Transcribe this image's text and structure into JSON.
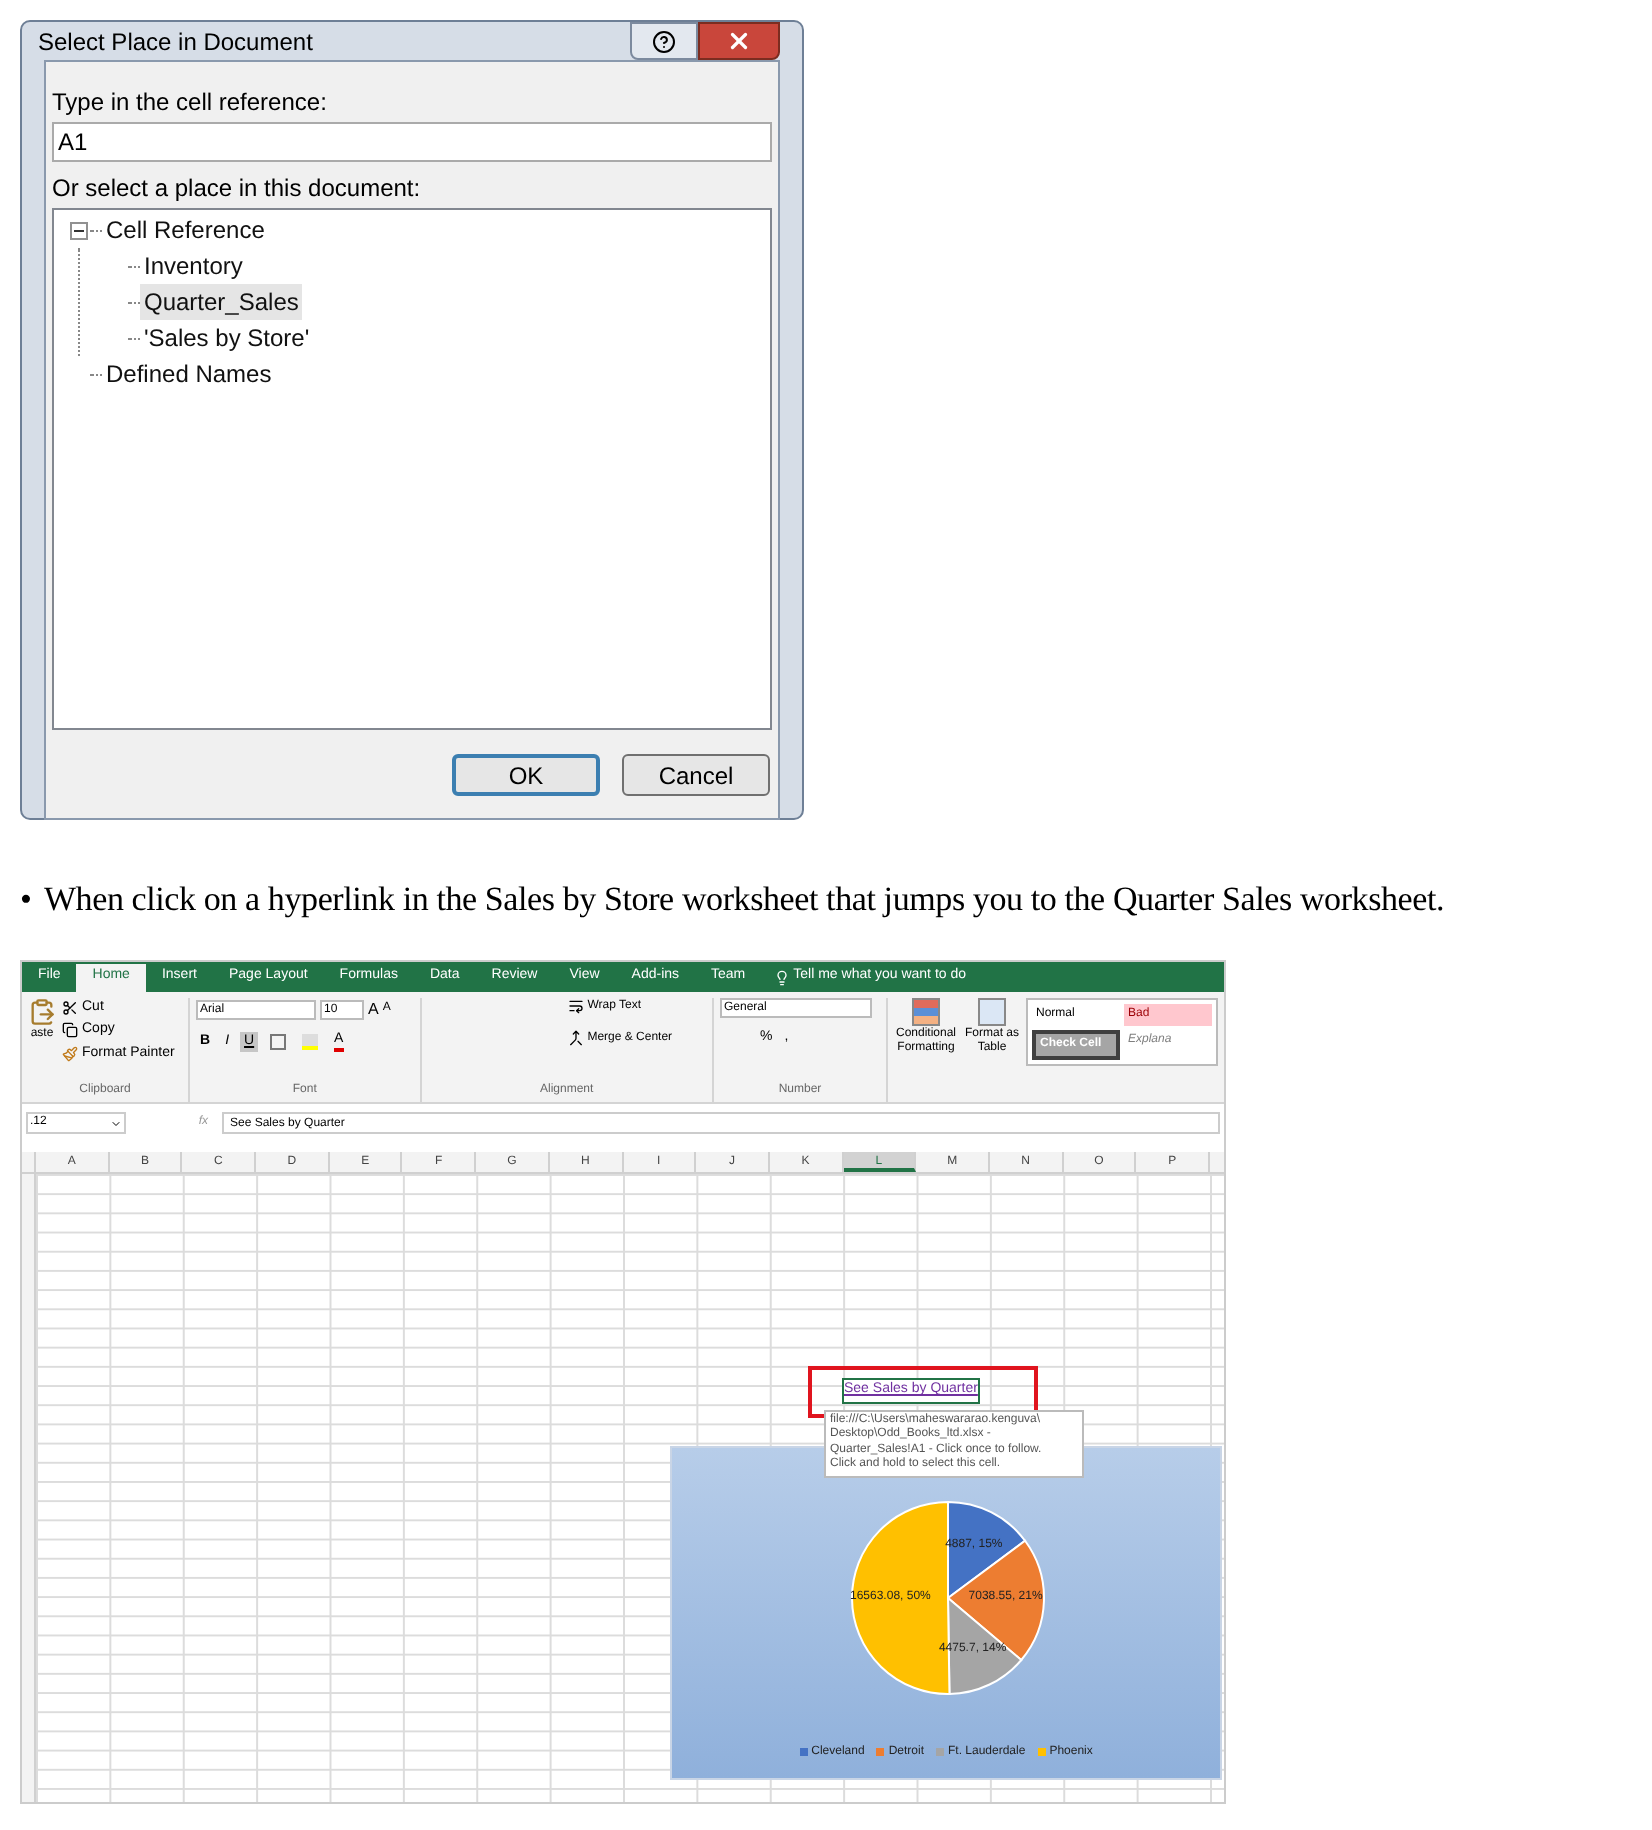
{
  "dialog": {
    "title": "Select Place in Document",
    "cell_reference_label": "Type in the cell reference:",
    "cell_reference": "A1",
    "place_label": "Or select a place in this document:",
    "tree": [
      {
        "label": "Cell Reference",
        "expanded": true,
        "selected": false,
        "children": [
          {
            "label": "Inventory",
            "selected": false
          },
          {
            "label": "Quarter_Sales",
            "selected": true
          },
          {
            "label": "'Sales by Store'",
            "selected": false
          }
        ]
      },
      {
        "label": "Defined Names",
        "selected": false
      }
    ],
    "buttons": [
      {
        "label": "OK",
        "default": true
      },
      {
        "label": "Cancel",
        "default": false
      }
    ]
  },
  "caption": {
    "bullet": "•",
    "text": "When click on a hyperlink in the Sales by Store worksheet that jumps you to the Quarter Sales worksheet."
  },
  "excel": {
    "tabs": [
      {
        "label": "File",
        "selected": false
      },
      {
        "label": "Home",
        "selected": true
      },
      {
        "label": "Insert",
        "selected": false
      },
      {
        "label": "Page Layout",
        "selected": false
      },
      {
        "label": "Formulas",
        "selected": false
      },
      {
        "label": "Data",
        "selected": false
      },
      {
        "label": "Review",
        "selected": false
      },
      {
        "label": "View",
        "selected": false
      },
      {
        "label": "Add-ins",
        "selected": false
      },
      {
        "label": "Team",
        "selected": false
      }
    ],
    "tell_me": "Tell me what you want to do",
    "clipboard": {
      "label": "Clipboard",
      "paste": "aste",
      "cut": "Cut",
      "copy": "Copy",
      "format_painter": "Format Painter"
    },
    "font": {
      "label": "Font",
      "font_name": "Arial",
      "font_size": "10",
      "grow": "A",
      "shrink": "A",
      "font_color": "A",
      "buttons": [
        {
          "label": "B",
          "pressed": false
        },
        {
          "label": "I",
          "pressed": false
        },
        {
          "label": "U",
          "pressed": true
        }
      ]
    },
    "alignment": {
      "label": "Alignment",
      "wrap": "Wrap Text",
      "merge": "Merge & Center"
    },
    "number": {
      "label": "Number",
      "format": "General",
      "percent": "%",
      "comma": ","
    },
    "styles": {
      "conditional": "Conditional Formatting",
      "format_table": "Format as Table",
      "cell_styles": [
        {
          "label": "Normal",
          "kind": "normal"
        },
        {
          "label": "Bad",
          "kind": "bad"
        },
        {
          "label": "Check Cell",
          "kind": "check"
        },
        {
          "label": "Explana",
          "kind": "explanatory"
        }
      ]
    },
    "name_box": ".12",
    "formula_icon": "fx",
    "formula": "See Sales by Quarter",
    "columns": [
      {
        "label": "A",
        "selected": false
      },
      {
        "label": "B",
        "selected": false
      },
      {
        "label": "C",
        "selected": false
      },
      {
        "label": "D",
        "selected": false
      },
      {
        "label": "E",
        "selected": false
      },
      {
        "label": "F",
        "selected": false
      },
      {
        "label": "G",
        "selected": false
      },
      {
        "label": "H",
        "selected": false
      },
      {
        "label": "I",
        "selected": false
      },
      {
        "label": "J",
        "selected": false
      },
      {
        "label": "K",
        "selected": false
      },
      {
        "label": "L",
        "selected": true
      },
      {
        "label": "M",
        "selected": false
      },
      {
        "label": "N",
        "selected": false
      },
      {
        "label": "O",
        "selected": false
      },
      {
        "label": "P",
        "selected": false
      }
    ],
    "hyperlink": "See Sales by Quarter",
    "tooltip": [
      "file:///C:\\Users\\maheswararao.kenguva\\",
      "Desktop\\Odd_Books_ltd.xlsx -",
      "Quarter_Sales!A1 - Click once to follow.",
      "Click and hold to select this cell."
    ],
    "chart": {
      "chart_data": {
        "type": "pie",
        "categories": [
          "Cleveland",
          "Detroit",
          "Ft. Lauderdale",
          "Phoenix"
        ],
        "values": [
          4887,
          7038.55,
          4475.7,
          16563.08
        ],
        "value_labels": [
          "4887, 15%",
          "7038.55, 21%",
          "4475.7, 14%",
          "16563.08, 50%"
        ],
        "colors": [
          "#4472c4",
          "#ed7d31",
          "#a5a5a5",
          "#ffc000"
        ],
        "legend": true
      }
    }
  }
}
